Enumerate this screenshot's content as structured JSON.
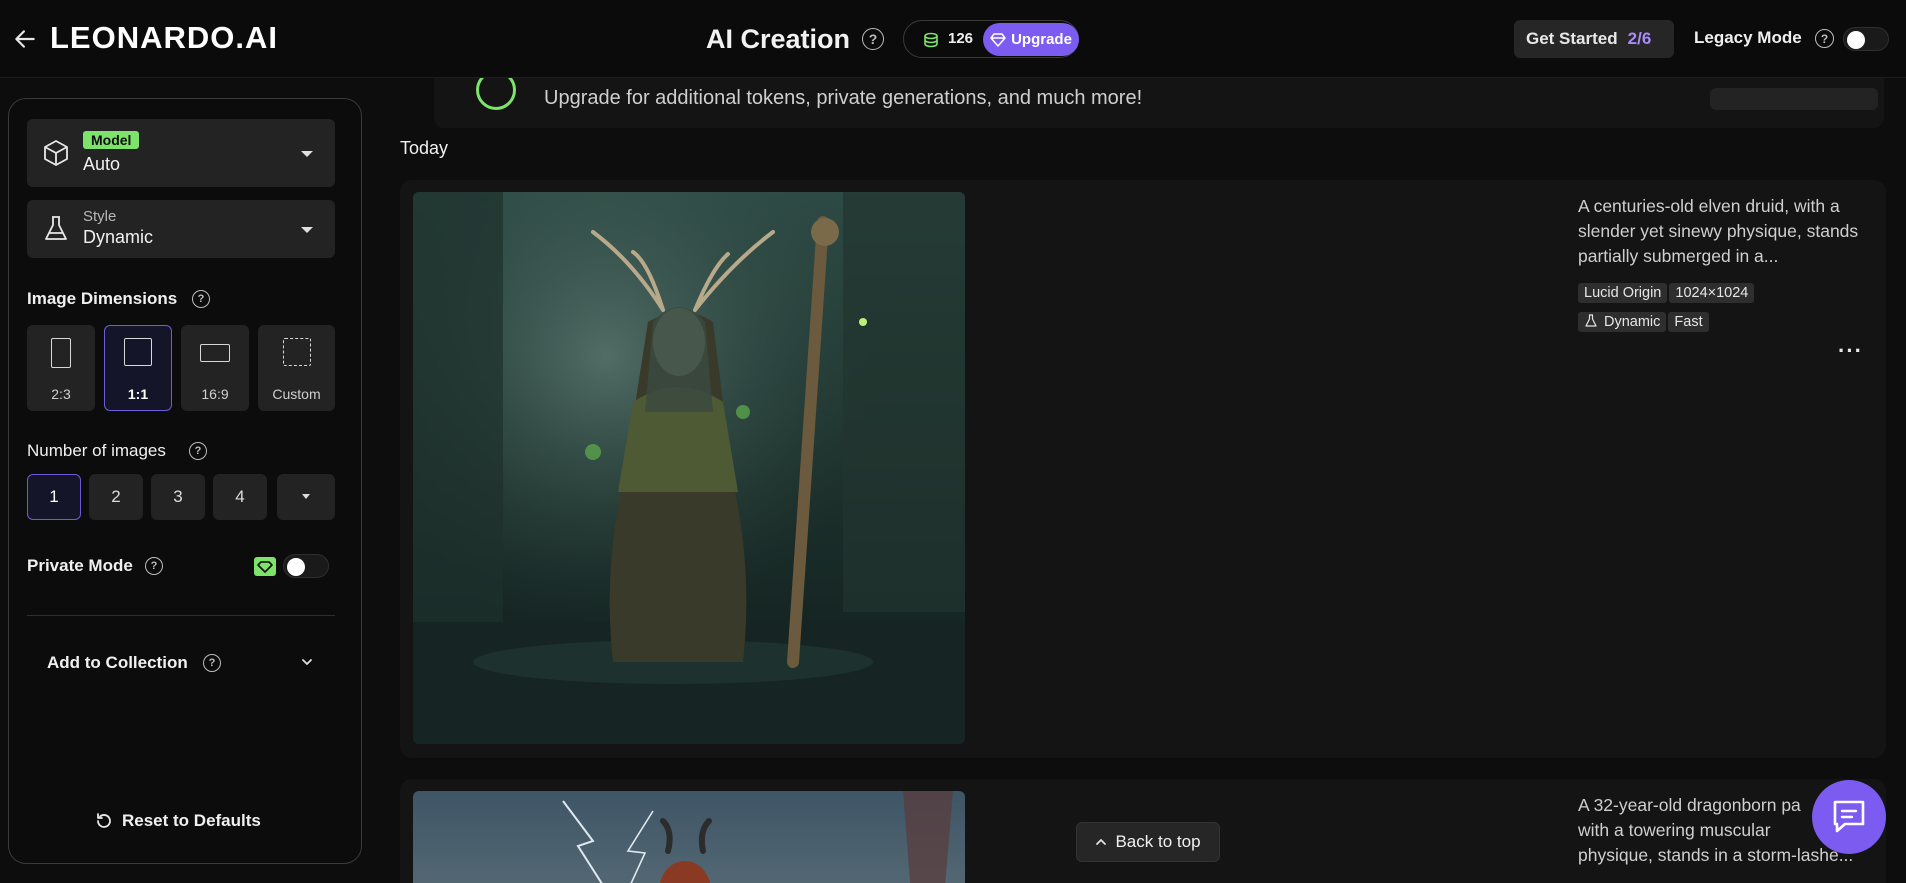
{
  "header": {
    "brand": "LEONARDO.AI",
    "title": "AI Creation",
    "tokens": "126",
    "upgrade_label": "Upgrade",
    "get_started": "Get Started",
    "get_started_progress": "2/6",
    "legacy_mode": "Legacy Mode"
  },
  "sidebar": {
    "model": {
      "badge": "Model",
      "value": "Auto"
    },
    "style": {
      "label": "Style",
      "value": "Dynamic"
    },
    "dimensions": {
      "title": "Image Dimensions",
      "options": [
        "2:3",
        "1:1",
        "16:9",
        "Custom"
      ],
      "selected": "1:1"
    },
    "num_images": {
      "title": "Number of images",
      "options": [
        "1",
        "2",
        "3",
        "4"
      ],
      "selected": "1"
    },
    "private_mode": "Private Mode",
    "add_to_collection": "Add to Collection",
    "reset": "Reset to Defaults"
  },
  "main": {
    "banner_text": "Upgrade for additional tokens, private generations, and much more!",
    "section": "Today",
    "generations": [
      {
        "description": "A centuries-old elven druid, with a slender yet sinewy physique, stands partially submerged in a...",
        "tags": [
          "Lucid Origin",
          "1024×1024"
        ],
        "tags2": [
          "Dynamic",
          "Fast"
        ]
      },
      {
        "description_lines": [
          "A 32-year-old dragonborn pa",
          "with a towering muscular",
          "physique, stands in a storm-lashe..."
        ]
      }
    ],
    "back_to_top": "Back to top"
  },
  "colors": {
    "accent": "#7b5bf0",
    "green": "#7de36a",
    "background": "#0d0d0d",
    "panel": "#232323"
  }
}
